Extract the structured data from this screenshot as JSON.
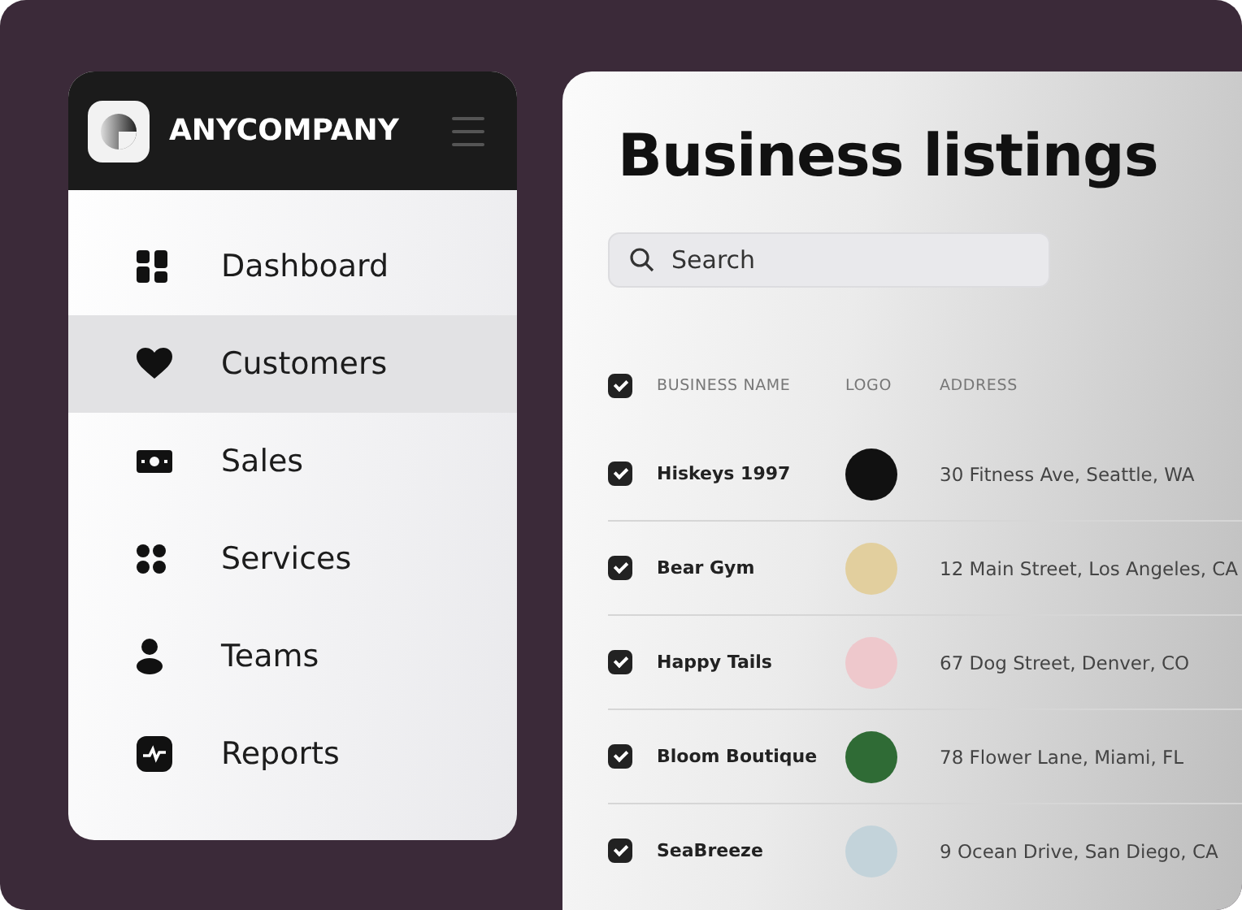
{
  "sidebar": {
    "brand": "ANYCOMPANY",
    "items": [
      {
        "label": "Dashboard",
        "selected": false
      },
      {
        "label": "Customers",
        "selected": true
      },
      {
        "label": "Sales",
        "selected": false
      },
      {
        "label": "Services",
        "selected": false
      },
      {
        "label": "Teams",
        "selected": false
      },
      {
        "label": "Reports",
        "selected": false
      }
    ]
  },
  "main": {
    "title": "Business listings",
    "search": {
      "placeholder": "Search"
    },
    "table": {
      "all_checked": true,
      "columns": [
        "BUSINESS NAME",
        "LOGO",
        "ADDRESS"
      ],
      "rows": [
        {
          "checked": true,
          "name": "Hiskeys 1997",
          "color": "#111111",
          "address": "30 Fitness Ave, Seattle, WA"
        },
        {
          "checked": true,
          "name": "Bear Gym",
          "color": "#e2cf9e",
          "address": "12 Main Street, Los Angeles, CA"
        },
        {
          "checked": true,
          "name": "Happy Tails",
          "color": "#eec8cc",
          "address": "67 Dog Street, Denver, CO"
        },
        {
          "checked": true,
          "name": "Bloom Boutique",
          "color": "#2f6b35",
          "address": "78 Flower Lane, Miami, FL"
        },
        {
          "checked": true,
          "name": "SeaBreeze",
          "color": "#c3d3da",
          "address": "9 Ocean Drive, San Diego, CA"
        }
      ]
    }
  }
}
